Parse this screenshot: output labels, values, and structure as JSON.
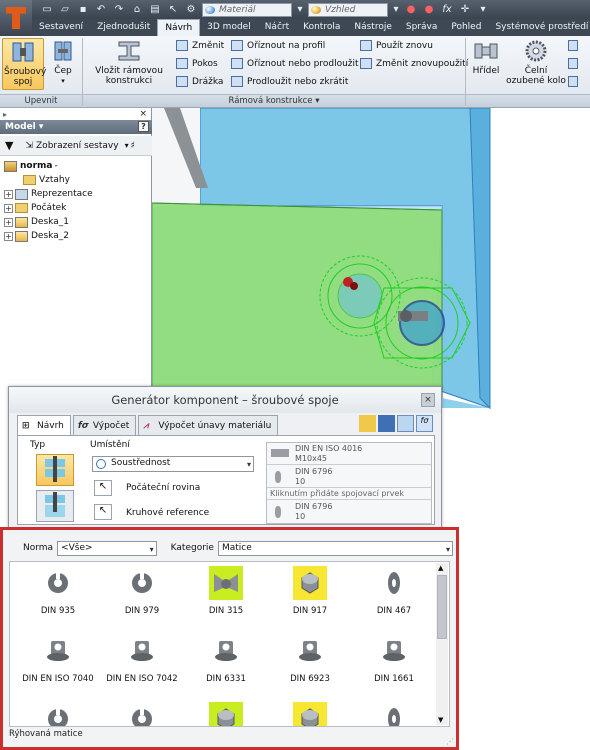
{
  "app": {
    "logo": "I"
  },
  "qat": {
    "material_placeholder": "Materiál",
    "appearance_placeholder": "Vzhled"
  },
  "tabs": [
    "Sestavení",
    "Zjednodušit",
    "Návrh",
    "3D model",
    "Náčrt",
    "Kontrola",
    "Nástroje",
    "Správa",
    "Pohled",
    "Systémové prostředí"
  ],
  "active_tab": "Návrh",
  "ribbon": {
    "upevnit": {
      "label": "Upevnit",
      "bolted": "Šroubový spoj",
      "pin": "Čep"
    },
    "frame": {
      "label": "Rámová konstrukce",
      "insert_frame": "Vložit rámovou konstrukci",
      "change": "Změnit",
      "cover": "Pokos",
      "groove": "Drážka",
      "trim_profile": "Oříznout na profil",
      "trim_extend": "Oříznout nebo prodloužit",
      "lengthen_shorten": "Prodloužit nebo zkrátit",
      "reuse": "Použít znovu",
      "change_reuse": "Změnit znovupoužití"
    },
    "power": {
      "shaft": "Hřídel",
      "gear": "Čelní ozubené kolo"
    }
  },
  "browser": {
    "title": "Model",
    "help": "?",
    "view_label": "Zobrazení sestavy",
    "root": "norma",
    "items": [
      "Vztahy",
      "Reprezentace",
      "Počátek",
      "Deska_1",
      "Deska_2"
    ]
  },
  "dialog": {
    "title": "Generátor komponent – šroubové spoje",
    "tabs": [
      "Návrh",
      "Výpočet",
      "Výpočet únavy materiálu"
    ],
    "type_label": "Typ",
    "placement_label": "Umístění",
    "placement_value": "Soustřednost",
    "start_plane": "Počáteční rovina",
    "circular_ref": "Kruhové reference",
    "parts": [
      {
        "line1": "DIN EN ISO  4016",
        "line2": "M10x45"
      },
      {
        "line1": "DIN  6796",
        "line2": "10"
      },
      {
        "line1": "DIN  6796",
        "line2": "10"
      }
    ],
    "add_hint": "Kliknutím přidáte spojovací prvek"
  },
  "library": {
    "norma_label": "Norma",
    "norma_value": "<Vše>",
    "category_label": "Kategorie",
    "category_value": "Matice",
    "items": [
      {
        "label": "DIN  935",
        "shape": "castle",
        "highlight": "none"
      },
      {
        "label": "DIN  979",
        "shape": "castle",
        "highlight": "none"
      },
      {
        "label": "DIN  315",
        "shape": "wing",
        "highlight": "green"
      },
      {
        "label": "DIN  917",
        "shape": "cap",
        "highlight": "yellow"
      },
      {
        "label": "DIN  467",
        "shape": "thin",
        "highlight": "none"
      },
      {
        "label": "DIN EN ISO  7040",
        "shape": "flange",
        "highlight": "none"
      },
      {
        "label": "DIN EN ISO  7042",
        "shape": "flange",
        "highlight": "none"
      },
      {
        "label": "DIN  6331",
        "shape": "flange",
        "highlight": "none"
      },
      {
        "label": "DIN  6923",
        "shape": "flange",
        "highlight": "none"
      },
      {
        "label": "DIN  1661",
        "shape": "flange",
        "highlight": "none"
      },
      {
        "label": "",
        "shape": "castle",
        "highlight": "none"
      },
      {
        "label": "",
        "shape": "castle",
        "highlight": "none"
      },
      {
        "label": "",
        "shape": "cap",
        "highlight": "green"
      },
      {
        "label": "",
        "shape": "cap",
        "highlight": "yellow"
      },
      {
        "label": "",
        "shape": "thin",
        "highlight": "none"
      }
    ],
    "status": "Rýhovaná matice"
  },
  "colors": {
    "highlight_border": "#cc2d2d",
    "selected_green": "#c8ee22",
    "selected_yellow": "#f7e733",
    "plate_blue": "#6fc3e8",
    "plate_green": "#8fdc7a"
  }
}
